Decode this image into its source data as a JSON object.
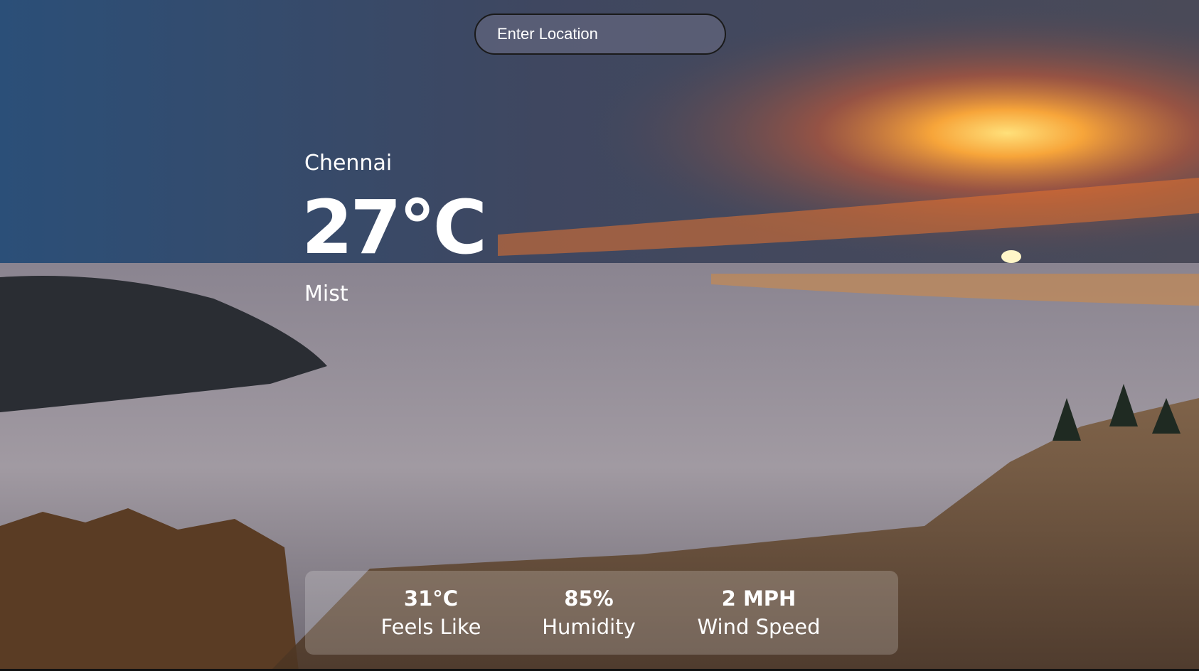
{
  "search": {
    "placeholder": "Enter Location",
    "value": ""
  },
  "weather": {
    "city": "Chennai",
    "temperature": "27°C",
    "description": "Mist"
  },
  "stats": {
    "feels_like": {
      "value": "31°C",
      "label": "Feels Like"
    },
    "humidity": {
      "value": "85%",
      "label": "Humidity"
    },
    "wind_speed": {
      "value": "2 MPH",
      "label": "Wind Speed"
    }
  },
  "colors": {
    "text": "#ffffff",
    "sunset": "#f2a23a",
    "sky": "#2f4a6b"
  }
}
